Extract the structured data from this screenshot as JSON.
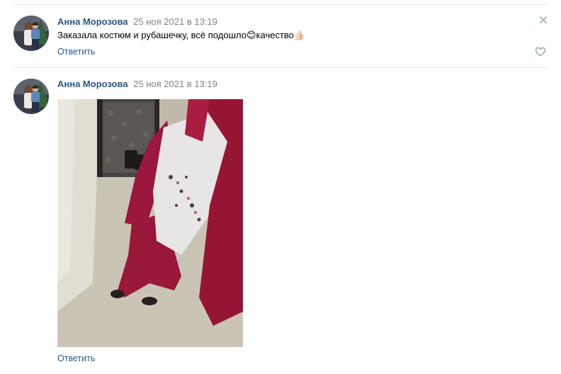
{
  "comments": [
    {
      "author": "Анна Морозова",
      "date": "25 ноя 2021 в 13:19",
      "text_before": "Заказала костюм и рубашечку, всё подошло",
      "emoji_smile": "😊",
      "text_after": "качество",
      "emoji_thumb": "👍🏻",
      "reply_label": "Ответить",
      "icons": [
        "avatar",
        "close-icon",
        "heart-icon"
      ]
    },
    {
      "author": "Анна Морозова",
      "date": "25 ноя 2021 в 13:19",
      "reply_label": "Ответить",
      "icons": [
        "avatar",
        "photo"
      ]
    }
  ],
  "colors": {
    "link": "#2a5885",
    "date": "#828282",
    "divider": "#e7e8ec",
    "icon": "#aeb7c2"
  }
}
